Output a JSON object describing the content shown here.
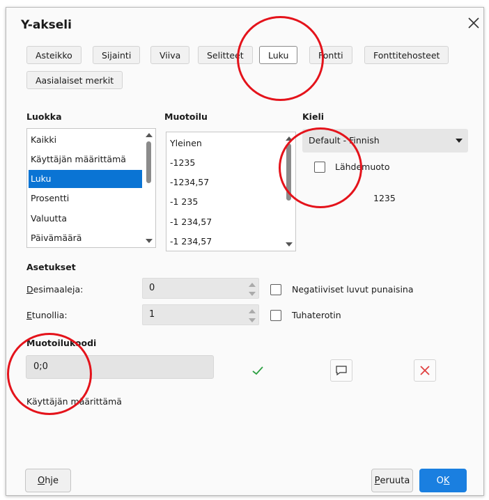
{
  "dialog": {
    "title": "Y-akseli"
  },
  "tabs": [
    {
      "label": "Asteikko",
      "active": false
    },
    {
      "label": "Sijainti",
      "active": false
    },
    {
      "label": "Viiva",
      "active": false
    },
    {
      "label": "Selitteet",
      "active": false
    },
    {
      "label": "Luku",
      "active": true
    },
    {
      "label": "Fontti",
      "active": false
    },
    {
      "label": "Fonttitehosteet",
      "active": false
    },
    {
      "label": "Aasialaiset merkit",
      "active": false
    }
  ],
  "category": {
    "label": "Luokka",
    "items": [
      "Kaikki",
      "Käyttäjän määrittämä",
      "Luku",
      "Prosentti",
      "Valuutta",
      "Päivämäärä"
    ],
    "selected": "Luku"
  },
  "format": {
    "label": "Muotoilu",
    "items": [
      "Yleinen",
      "-1235",
      "-1234,57",
      "-1 235",
      "-1 234,57",
      "-1 234,57"
    ]
  },
  "language": {
    "label": "Kieli",
    "value": "Default - Finnish",
    "source_format_label": "Lähdemuoto",
    "source_format_checked": false,
    "preview": "1235"
  },
  "options": {
    "label": "Asetukset",
    "decimals_label_first": "D",
    "decimals_label_rest": "esimaaleja:",
    "decimals_value": "0",
    "leading_zeros_label_first": "E",
    "leading_zeros_label_rest": "tunollia:",
    "leading_zeros_value": "1",
    "negative_red_label": "Negatiiviset luvut punaisina",
    "negative_red_checked": false,
    "thousands_sep_label": "Tuhaterotin",
    "thousands_sep_checked": false
  },
  "format_code": {
    "label": "Muotoilukoodi",
    "value": "0;0",
    "description": "Käyttäjän määrittämä"
  },
  "buttons": {
    "help_first": "O",
    "help_rest": "hje",
    "cancel_first": "P",
    "cancel_rest": "eruuta",
    "ok_first": "O",
    "ok_rest": "K"
  },
  "colors": {
    "accent": "#0a74d4",
    "annotation": "#e4131b",
    "accept": "#2ea043",
    "delete": "#e04040"
  }
}
